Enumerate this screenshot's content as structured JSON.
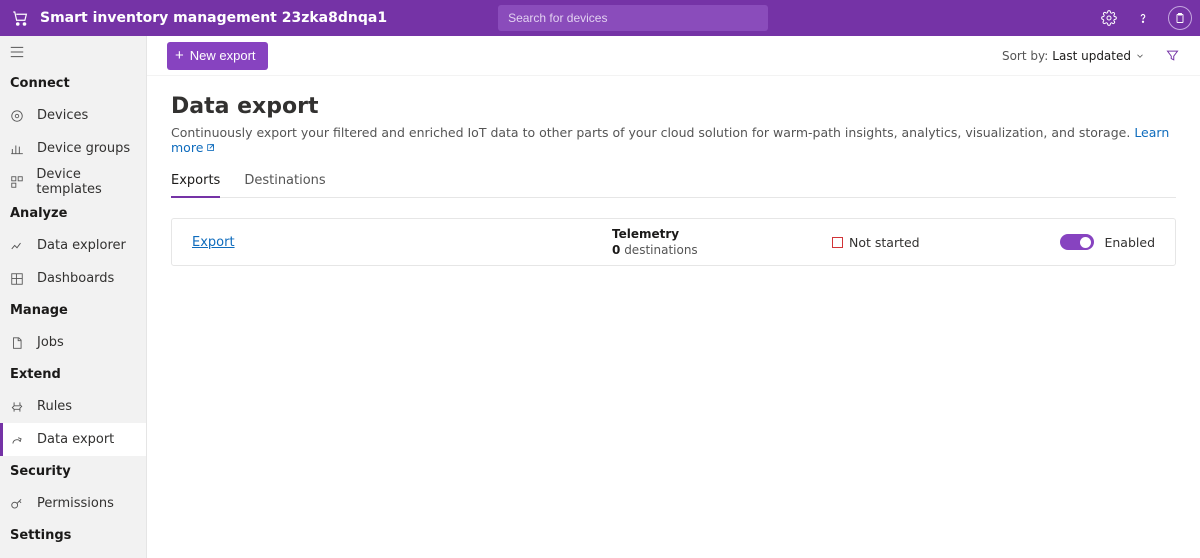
{
  "header": {
    "app_title": "Smart inventory management 23zka8dnqa1",
    "search_placeholder": "Search for devices"
  },
  "sidebar": {
    "sections": [
      {
        "label": "Connect",
        "items": [
          "Devices",
          "Device groups",
          "Device templates"
        ]
      },
      {
        "label": "Analyze",
        "items": [
          "Data explorer",
          "Dashboards"
        ]
      },
      {
        "label": "Manage",
        "items": [
          "Jobs"
        ]
      },
      {
        "label": "Extend",
        "items": [
          "Rules",
          "Data export"
        ]
      },
      {
        "label": "Security",
        "items": [
          "Permissions"
        ]
      },
      {
        "label": "Settings",
        "items": []
      }
    ],
    "active_item": "Data export"
  },
  "toolbar": {
    "new_export_label": "New export",
    "sort_label": "Sort by:",
    "sort_value": "Last updated"
  },
  "page": {
    "title": "Data export",
    "description": "Continuously export your filtered and enriched IoT data to other parts of your cloud solution for warm-path insights, analytics, visualization, and storage.",
    "learn_more": "Learn more"
  },
  "tabs": {
    "items": [
      "Exports",
      "Destinations"
    ],
    "active": "Exports"
  },
  "exports": [
    {
      "name": "Export",
      "telemetry_title": "Telemetry",
      "destinations_count": "0",
      "destinations_label": "destinations",
      "status": "Not started",
      "enabled_label": "Enabled",
      "enabled": true
    }
  ]
}
